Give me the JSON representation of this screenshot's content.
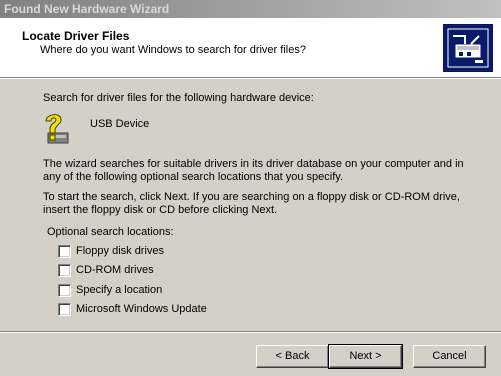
{
  "window": {
    "title": "Found New Hardware Wizard"
  },
  "header": {
    "title": "Locate Driver Files",
    "subtitle": "Where do you want Windows to search for driver files?",
    "icon": "hardware-wizard-icon"
  },
  "body": {
    "search_intro": "Search for driver files for the following hardware device:",
    "device_icon": "unknown-device-question-icon",
    "device_name": "USB Device",
    "paragraph1_line1": "The wizard searches for suitable drivers in its driver database on your computer and in",
    "paragraph1_line2": "any of the following optional search locations that you specify.",
    "paragraph2_line1": "To start the search, click Next. If you are searching on a floppy disk or CD-ROM drive,",
    "paragraph2_line2": "insert the floppy disk or CD before clicking Next.",
    "optional_heading": "Optional search locations:",
    "options": [
      {
        "label": "Floppy disk drives",
        "checked": false
      },
      {
        "label": "CD-ROM drives",
        "checked": false
      },
      {
        "label": "Specify a location",
        "checked": false
      },
      {
        "label": "Microsoft Windows Update",
        "checked": false
      }
    ]
  },
  "buttons": {
    "back": "< Back",
    "next": "Next >",
    "cancel": "Cancel"
  }
}
